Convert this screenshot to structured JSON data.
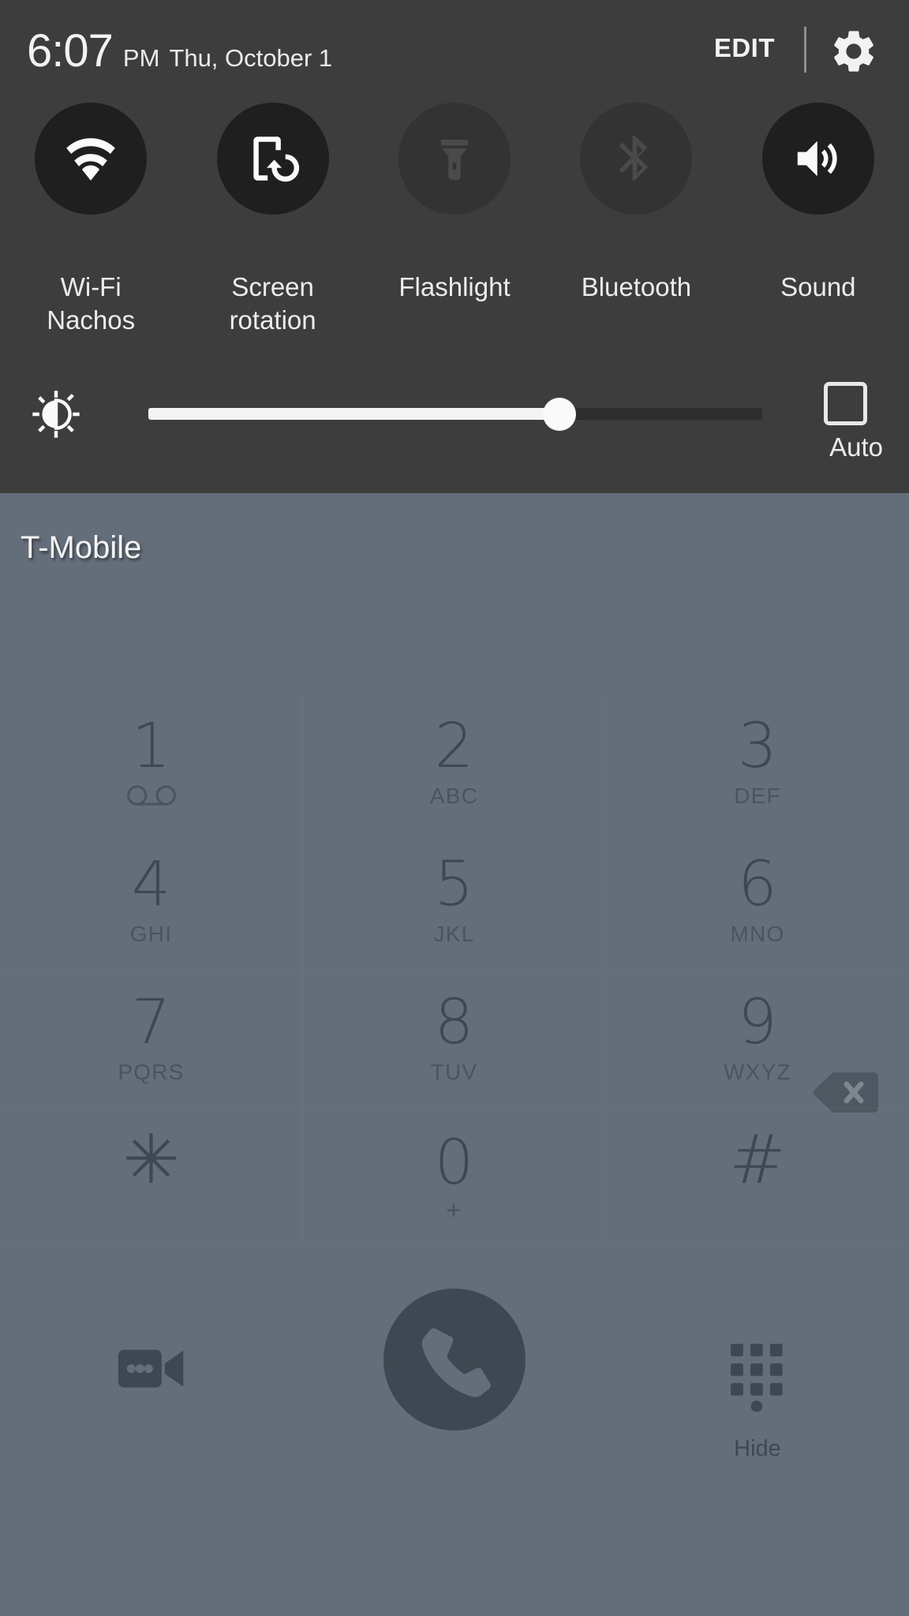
{
  "quick_settings": {
    "clock": {
      "time": "6:07",
      "ampm": "PM",
      "date": "Thu, October 1"
    },
    "edit_label": "EDIT",
    "gear_icon": "gear-icon",
    "toggles": [
      {
        "icon": "wifi-icon",
        "label": "Wi-Fi",
        "sublabel": "Nachos",
        "state": "on"
      },
      {
        "icon": "screen-rotation-icon",
        "label": "Screen",
        "sublabel": "rotation",
        "state": "on"
      },
      {
        "icon": "flashlight-icon",
        "label": "Flashlight",
        "sublabel": "",
        "state": "off"
      },
      {
        "icon": "bluetooth-icon",
        "label": "Bluetooth",
        "sublabel": "",
        "state": "off"
      },
      {
        "icon": "sound-icon",
        "label": "Sound",
        "sublabel": "",
        "state": "on"
      }
    ],
    "brightness": {
      "icon": "brightness-icon",
      "value": 67,
      "auto_label": "Auto",
      "auto_checked": false
    }
  },
  "dialer": {
    "carrier": "T-Mobile",
    "number": "",
    "number_placeholder": "",
    "backspace_icon": "backspace-icon",
    "keys": [
      {
        "digit": "1",
        "sub": "",
        "icon": "voicemail-icon"
      },
      {
        "digit": "2",
        "sub": "ABC",
        "icon": ""
      },
      {
        "digit": "3",
        "sub": "DEF",
        "icon": ""
      },
      {
        "digit": "4",
        "sub": "GHI",
        "icon": ""
      },
      {
        "digit": "5",
        "sub": "JKL",
        "icon": ""
      },
      {
        "digit": "6",
        "sub": "MNO",
        "icon": ""
      },
      {
        "digit": "7",
        "sub": "PQRS",
        "icon": ""
      },
      {
        "digit": "8",
        "sub": "TUV",
        "icon": ""
      },
      {
        "digit": "9",
        "sub": "WXYZ",
        "icon": ""
      },
      {
        "digit": "✳",
        "sub": "",
        "icon": ""
      },
      {
        "digit": "0",
        "sub": "+",
        "icon": ""
      },
      {
        "digit": "#",
        "sub": "",
        "icon": ""
      }
    ],
    "actions": {
      "video_call_icon": "video-call-icon",
      "call_icon": "call-icon",
      "hide_icon": "keypad-icon",
      "hide_label": "Hide"
    }
  },
  "colors": {
    "panel_bg": "#3d3d3d",
    "dialer_bg": "#646e7a",
    "accent_text": "#f2f2f2",
    "key_text": "#3e4852",
    "toggle_on_bg": "#1f1f1f",
    "toggle_off_bg": "#333333"
  }
}
